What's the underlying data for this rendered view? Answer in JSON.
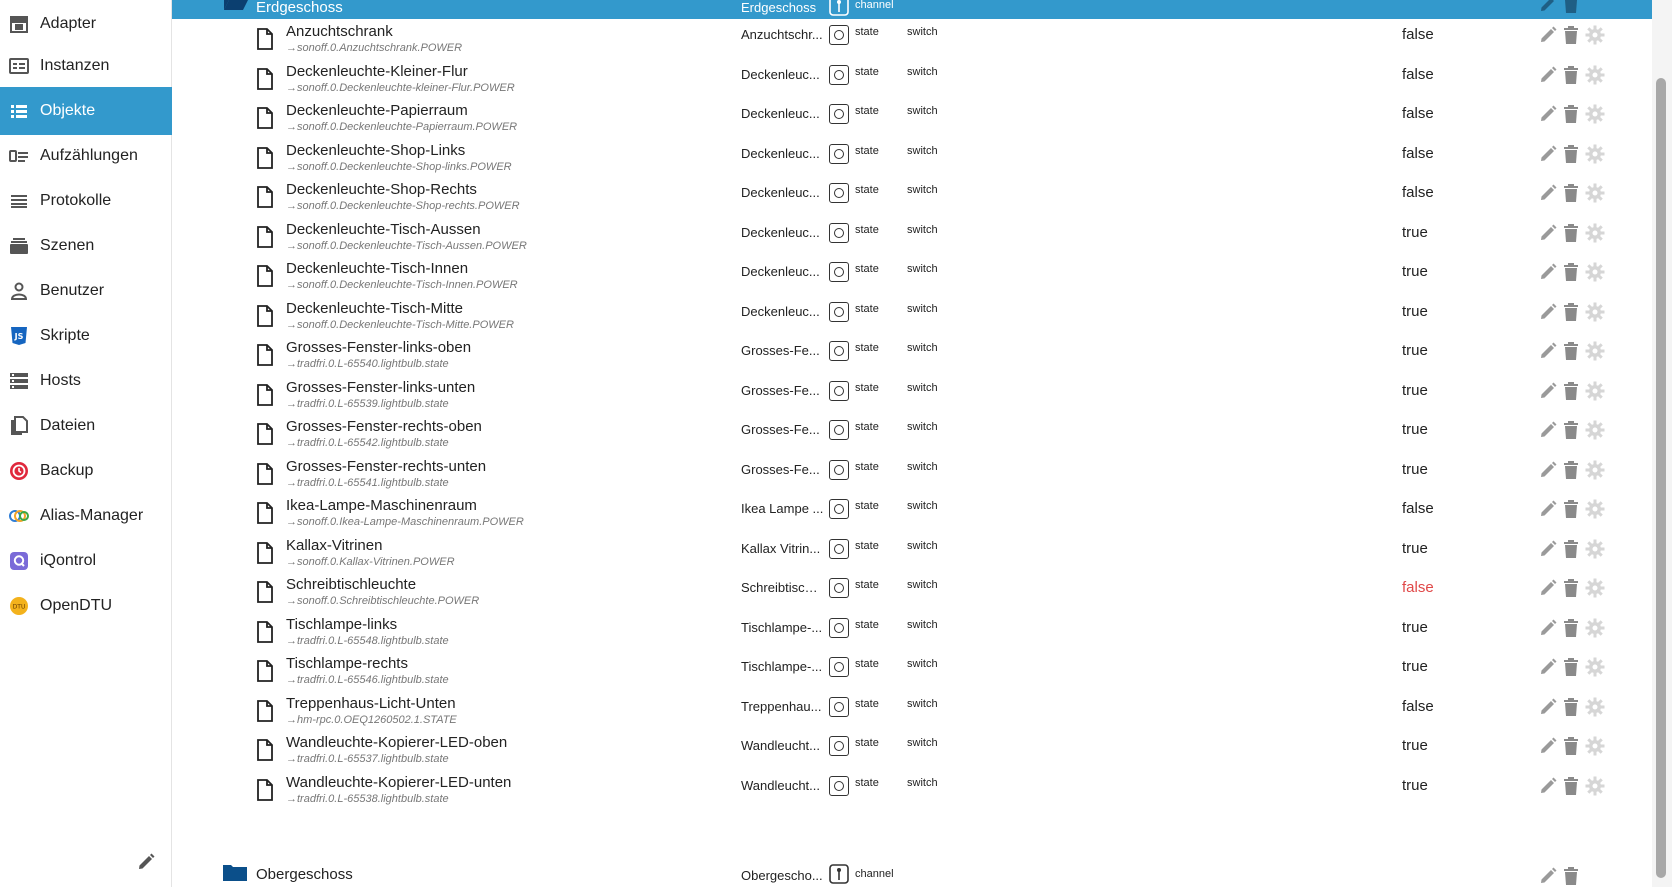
{
  "sidebar": {
    "items": [
      {
        "label": "Adapter",
        "icon": "adapter-icon"
      },
      {
        "label": "Instanzen",
        "icon": "instances-icon"
      },
      {
        "label": "Objekte",
        "icon": "objects-list-icon"
      },
      {
        "label": "Aufzählungen",
        "icon": "enums-icon"
      },
      {
        "label": "Protokolle",
        "icon": "logs-icon"
      },
      {
        "label": "Szenen",
        "icon": "scenes-icon"
      },
      {
        "label": "Benutzer",
        "icon": "user-icon"
      },
      {
        "label": "Skripte",
        "icon": "js-icon"
      },
      {
        "label": "Hosts",
        "icon": "hosts-icon"
      },
      {
        "label": "Dateien",
        "icon": "files-icon"
      },
      {
        "label": "Backup",
        "icon": "backup-icon"
      },
      {
        "label": "Alias-Manager",
        "icon": "alias-icon"
      },
      {
        "label": "iQontrol",
        "icon": "iqontrol-icon"
      },
      {
        "label": "OpenDTU",
        "icon": "opendtu-icon"
      }
    ],
    "active_index": 2
  },
  "colors": {
    "accent": "#3399cc",
    "false_red": "#e04848"
  },
  "header_row": {
    "name": "Erdgeschoss",
    "display": "Erdgeschoss",
    "type": "channel"
  },
  "rows": [
    {
      "name": "Anzuchtschrank",
      "id": "→sonoff.0.Anzuchtschrank.POWER",
      "display": "Anzuchtschr...",
      "type": "state",
      "role": "switch",
      "value": "false"
    },
    {
      "name": "Deckenleuchte-Kleiner-Flur",
      "id": "→sonoff.0.Deckenleuchte-kleiner-Flur.POWER",
      "display": "Deckenleuc...",
      "type": "state",
      "role": "switch",
      "value": "false"
    },
    {
      "name": "Deckenleuchte-Papierraum",
      "id": "→sonoff.0.Deckenleuchte-Papierraum.POWER",
      "display": "Deckenleuc...",
      "type": "state",
      "role": "switch",
      "value": "false"
    },
    {
      "name": "Deckenleuchte-Shop-Links",
      "id": "→sonoff.0.Deckenleuchte-Shop-links.POWER",
      "display": "Deckenleuc...",
      "type": "state",
      "role": "switch",
      "value": "false"
    },
    {
      "name": "Deckenleuchte-Shop-Rechts",
      "id": "→sonoff.0.Deckenleuchte-Shop-rechts.POWER",
      "display": "Deckenleuc...",
      "type": "state",
      "role": "switch",
      "value": "false"
    },
    {
      "name": "Deckenleuchte-Tisch-Aussen",
      "id": "→sonoff.0.Deckenleuchte-Tisch-Aussen.POWER",
      "display": "Deckenleuc...",
      "type": "state",
      "role": "switch",
      "value": "true"
    },
    {
      "name": "Deckenleuchte-Tisch-Innen",
      "id": "→sonoff.0.Deckenleuchte-Tisch-Innen.POWER",
      "display": "Deckenleuc...",
      "type": "state",
      "role": "switch",
      "value": "true"
    },
    {
      "name": "Deckenleuchte-Tisch-Mitte",
      "id": "→sonoff.0.Deckenleuchte-Tisch-Mitte.POWER",
      "display": "Deckenleuc...",
      "type": "state",
      "role": "switch",
      "value": "true"
    },
    {
      "name": "Grosses-Fenster-links-oben",
      "id": "→tradfri.0.L-65540.lightbulb.state",
      "display": "Grosses-Fe...",
      "type": "state",
      "role": "switch",
      "value": "true"
    },
    {
      "name": "Grosses-Fenster-links-unten",
      "id": "→tradfri.0.L-65539.lightbulb.state",
      "display": "Grosses-Fe...",
      "type": "state",
      "role": "switch",
      "value": "true"
    },
    {
      "name": "Grosses-Fenster-rechts-oben",
      "id": "→tradfri.0.L-65542.lightbulb.state",
      "display": "Grosses-Fe...",
      "type": "state",
      "role": "switch",
      "value": "true"
    },
    {
      "name": "Grosses-Fenster-rechts-unten",
      "id": "→tradfri.0.L-65541.lightbulb.state",
      "display": "Grosses-Fe...",
      "type": "state",
      "role": "switch",
      "value": "true"
    },
    {
      "name": "Ikea-Lampe-Maschinenraum",
      "id": "→sonoff.0.Ikea-Lampe-Maschinenraum.POWER",
      "display": "Ikea Lampe ...",
      "type": "state",
      "role": "switch",
      "value": "false"
    },
    {
      "name": "Kallax-Vitrinen",
      "id": "→sonoff.0.Kallax-Vitrinen.POWER",
      "display": "Kallax Vitrin...",
      "type": "state",
      "role": "switch",
      "value": "true"
    },
    {
      "name": "Schreibtischleuchte",
      "id": "→sonoff.0.Schreibtischleuchte.POWER",
      "display": "Schreibtischl...",
      "type": "state",
      "role": "switch",
      "value": "false",
      "value_red": true
    },
    {
      "name": "Tischlampe-links",
      "id": "→tradfri.0.L-65548.lightbulb.state",
      "display": "Tischlampe-...",
      "type": "state",
      "role": "switch",
      "value": "true"
    },
    {
      "name": "Tischlampe-rechts",
      "id": "→tradfri.0.L-65546.lightbulb.state",
      "display": "Tischlampe-...",
      "type": "state",
      "role": "switch",
      "value": "true"
    },
    {
      "name": "Treppenhaus-Licht-Unten",
      "id": "→hm-rpc.0.OEQ1260502.1.STATE",
      "display": "Treppenhau...",
      "type": "state",
      "role": "switch",
      "value": "false"
    },
    {
      "name": "Wandleuchte-Kopierer-LED-oben",
      "id": "→tradfri.0.L-65537.lightbulb.state",
      "display": "Wandleucht...",
      "type": "state",
      "role": "switch",
      "value": "true"
    },
    {
      "name": "Wandleuchte-Kopierer-LED-unten",
      "id": "→tradfri.0.L-65538.lightbulb.state",
      "display": "Wandleucht...",
      "type": "state",
      "role": "switch",
      "value": "true"
    }
  ],
  "footer_row": {
    "name": "Obergeschoss",
    "display": "Obergescho...",
    "type": "channel"
  }
}
